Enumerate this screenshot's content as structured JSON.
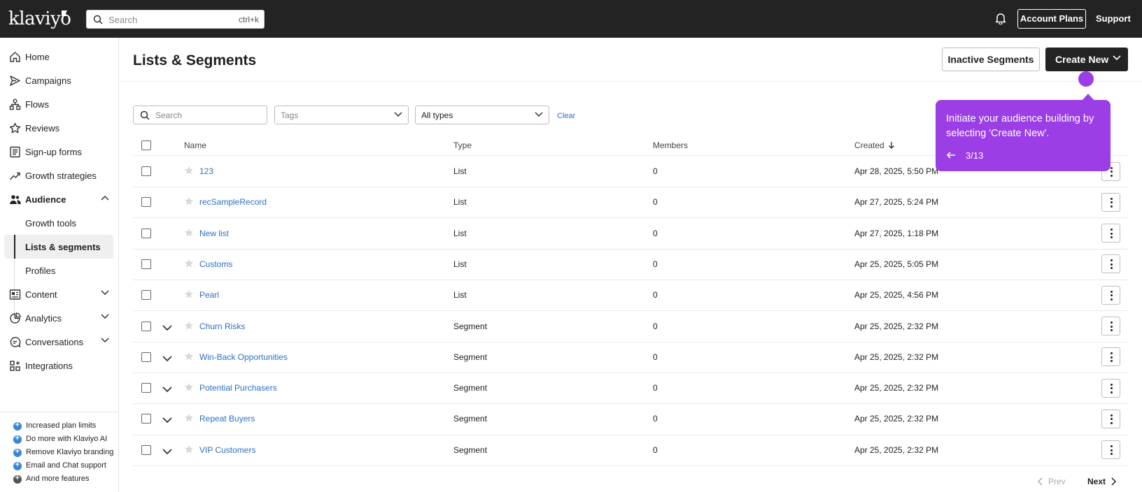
{
  "topbar": {
    "logo": "klaviyo",
    "search_placeholder": "Search",
    "search_shortcut": "ctrl+k",
    "account_plans": "Account Plans",
    "support": "Support"
  },
  "sidebar": {
    "items": [
      {
        "label": "Home",
        "icon": "home-icon"
      },
      {
        "label": "Campaigns",
        "icon": "send-icon"
      },
      {
        "label": "Flows",
        "icon": "flow-icon"
      },
      {
        "label": "Reviews",
        "icon": "star-icon"
      },
      {
        "label": "Sign-up forms",
        "icon": "form-icon"
      },
      {
        "label": "Growth strategies",
        "icon": "trend-icon"
      },
      {
        "label": "Audience",
        "icon": "people-icon"
      },
      {
        "label": "Content",
        "icon": "content-icon"
      },
      {
        "label": "Analytics",
        "icon": "pie-icon"
      },
      {
        "label": "Conversations",
        "icon": "chat-icon"
      },
      {
        "label": "Integrations",
        "icon": "grid-icon"
      }
    ],
    "audience_sub": [
      "Growth tools",
      "Lists & segments",
      "Profiles"
    ],
    "features": [
      "Increased plan limits",
      "Do more with Klaviyo AI",
      "Remove Klaviyo branding",
      "Email and Chat support",
      "And more features"
    ]
  },
  "main": {
    "title": "Lists & Segments",
    "inactive_segments": "Inactive Segments",
    "create_new": "Create New",
    "filters": {
      "search_placeholder": "Search",
      "tags_placeholder": "Tags",
      "type_value": "All types",
      "clear": "Clear"
    },
    "columns": {
      "name": "Name",
      "type": "Type",
      "members": "Members",
      "created": "Created"
    },
    "rows": [
      {
        "name": "123",
        "type": "List",
        "members": "0",
        "created": "Apr 28, 2025, 5:50 PM"
      },
      {
        "name": "recSampleRecord",
        "type": "List",
        "members": "0",
        "created": "Apr 27, 2025, 5:24 PM"
      },
      {
        "name": "New list",
        "type": "List",
        "members": "0",
        "created": "Apr 27, 2025, 1:18 PM"
      },
      {
        "name": "Customs",
        "type": "List",
        "members": "0",
        "created": "Apr 25, 2025, 5:05 PM"
      },
      {
        "name": "Pearl",
        "type": "List",
        "members": "0",
        "created": "Apr 25, 2025, 4:56 PM"
      },
      {
        "name": "Churn Risks",
        "type": "Segment",
        "members": "0",
        "created": "Apr 25, 2025, 2:32 PM"
      },
      {
        "name": "Win-Back Opportunities",
        "type": "Segment",
        "members": "0",
        "created": "Apr 25, 2025, 2:32 PM"
      },
      {
        "name": "Potential Purchasers",
        "type": "Segment",
        "members": "0",
        "created": "Apr 25, 2025, 2:32 PM"
      },
      {
        "name": "Repeat Buyers",
        "type": "Segment",
        "members": "0",
        "created": "Apr 25, 2025, 2:32 PM"
      },
      {
        "name": "VIP Customers",
        "type": "Segment",
        "members": "0",
        "created": "Apr 25, 2025, 2:32 PM"
      }
    ],
    "pager": {
      "prev": "Prev",
      "next": "Next"
    }
  },
  "tooltip": {
    "message": "Initiate your audience building by selecting 'Create New'.",
    "step": "3/13"
  },
  "colors": {
    "topbar": "#232323",
    "accent_purple": "#9b3ee6",
    "link_blue": "#2e6fc0"
  }
}
